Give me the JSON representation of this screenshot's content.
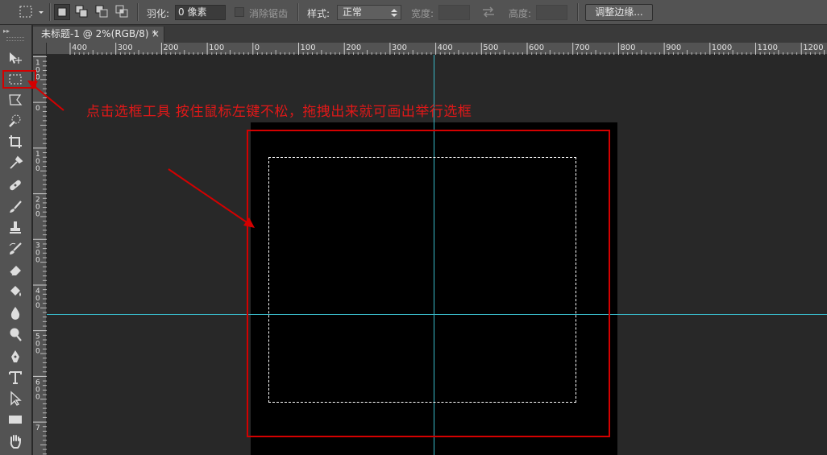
{
  "options_bar": {
    "feather_label": "羽化:",
    "feather_value": "0 像素",
    "antialias_label": "消除锯齿",
    "style_label": "样式:",
    "style_value": "正常",
    "width_label": "宽度:",
    "height_label": "高度:",
    "refine_edge_button": "调整边缘..."
  },
  "document_tab": {
    "title": "未标题-1 @ 2%(RGB/8) *",
    "close": "×"
  },
  "ruler_top": {
    "labels": [
      "400",
      "300",
      "200",
      "100",
      "0",
      "100",
      "200",
      "300",
      "400",
      "500",
      "600",
      "700",
      "800",
      "900",
      "1000",
      "1100",
      "1200"
    ]
  },
  "ruler_left": {
    "labels": [
      "100",
      "0",
      "100",
      "200",
      "300",
      "400",
      "500",
      "600",
      "7"
    ]
  },
  "tools": [
    "move-tool-icon",
    "rectangular-marquee-tool-icon",
    "lasso-tool-icon",
    "quick-selection-tool-icon",
    "crop-tool-icon",
    "eyedropper-tool-icon",
    "healing-brush-tool-icon",
    "brush-tool-icon",
    "clone-stamp-tool-icon",
    "history-brush-tool-icon",
    "eraser-tool-icon",
    "paint-bucket-tool-icon",
    "blur-tool-icon",
    "dodge-tool-icon",
    "pen-tool-icon",
    "type-tool-icon",
    "path-selection-tool-icon",
    "rectangle-tool-icon",
    "hand-tool-icon"
  ],
  "annotation": {
    "text": "点击选框工具  按住鼠标左键不松，拖拽出来就可画出举行选框",
    "color": "#e01818"
  },
  "colors": {
    "guide": "#39b9c8",
    "highlight": "#d40000",
    "panel": "#535353",
    "workspace": "#282828"
  }
}
